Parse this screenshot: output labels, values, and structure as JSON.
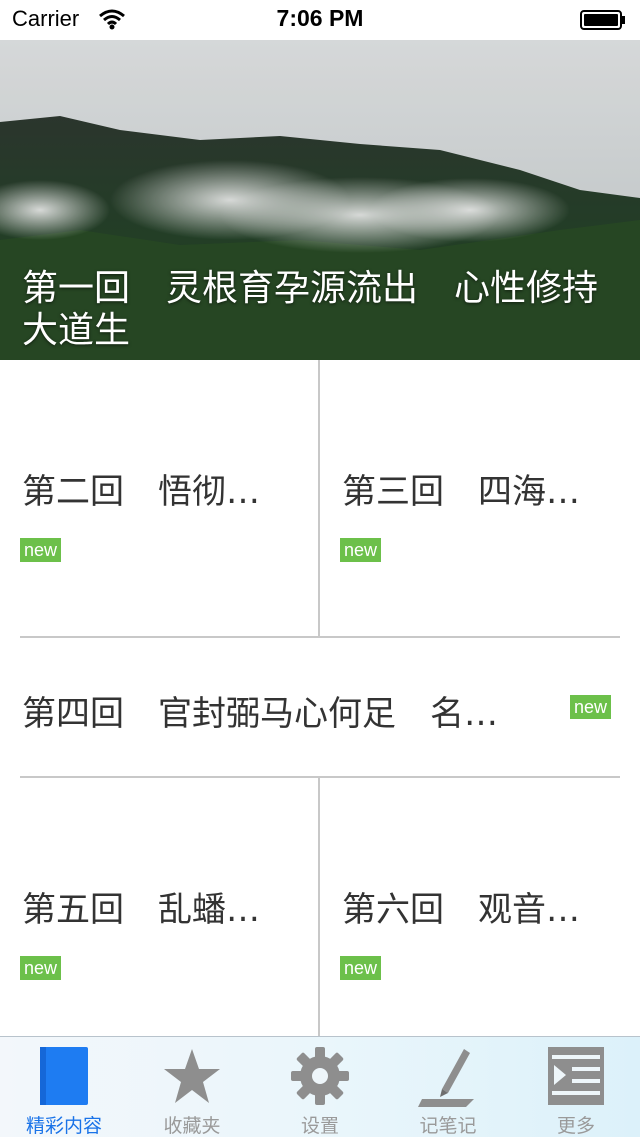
{
  "status_bar": {
    "carrier": "Carrier",
    "time": "7:06 PM"
  },
  "hero": {
    "title": "第一回　灵根育孕源流出　心性修持大道生"
  },
  "chapters": [
    {
      "title": "第二回　悟彻…",
      "badge": "new"
    },
    {
      "title": "第三回　四海…",
      "badge": "new"
    },
    {
      "title": "第四回　官封弼马心何足　名…",
      "badge": "new"
    },
    {
      "title": "第五回　乱蟠…",
      "badge": "new"
    },
    {
      "title": "第六回　观音…",
      "badge": "new"
    }
  ],
  "tabbar": {
    "tabs": [
      {
        "label": "精彩内容",
        "icon": "book-icon",
        "active": true
      },
      {
        "label": "收藏夹",
        "icon": "star-icon",
        "active": false
      },
      {
        "label": "设置",
        "icon": "gear-icon",
        "active": false
      },
      {
        "label": "记笔记",
        "icon": "pen-icon",
        "active": false
      },
      {
        "label": "更多",
        "icon": "list-icon",
        "active": false
      }
    ]
  },
  "colors": {
    "badge": "#6cc04a",
    "active_tab": "#1a73e8",
    "inactive_tab": "#9a9a9a"
  }
}
